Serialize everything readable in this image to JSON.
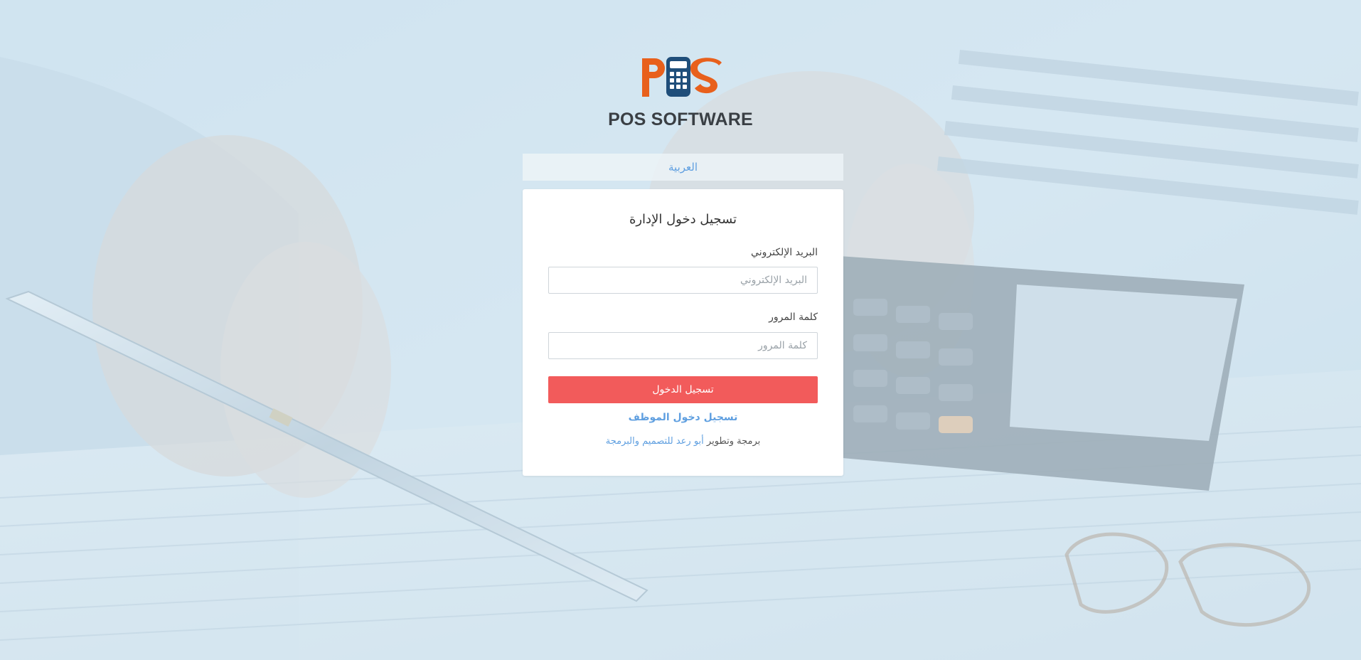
{
  "brand": {
    "logo_text": "POS SOFTWARE",
    "logo_colors": {
      "orange": "#e8601c",
      "blue": "#1f4e7a"
    }
  },
  "language": {
    "current_label": "العربية"
  },
  "login": {
    "title": "تسجيل دخول الإدارة",
    "email_label": "البريد الإلكتروني",
    "email_placeholder": "البريد الإلكتروني",
    "email_value": "",
    "password_label": "كلمة المرور",
    "password_placeholder": "كلمة المرور",
    "password_value": "",
    "submit_label": "تسجيل الدخول",
    "employee_login_label": "تسجيل دخول الموظف",
    "credit_prefix": "برمجة وتطوير",
    "credit_link": "أبو رعد للتصميم والبرمجة"
  },
  "colors": {
    "primary_button": "#f25b5b",
    "link": "#5f9fe0",
    "card_background": "#ffffff"
  }
}
